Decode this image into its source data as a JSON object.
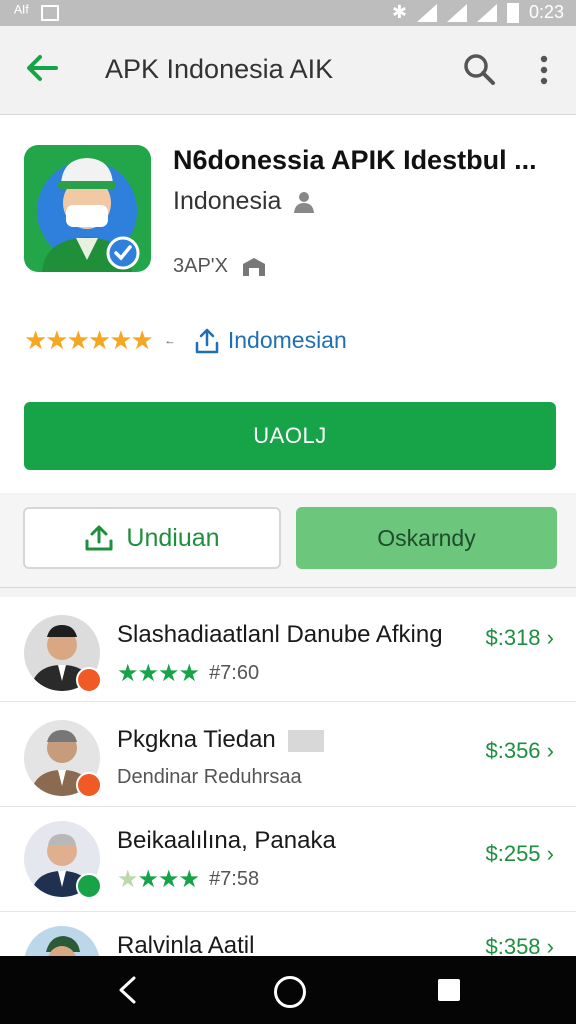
{
  "status_bar": {
    "left_text": "ᴬᴵᶠ",
    "time": "0:23"
  },
  "app_bar": {
    "title": "APK Indonesia AIK",
    "back_icon": "arrow-left-icon",
    "search_icon": "search-icon",
    "more_icon": "more-vert-icon"
  },
  "app": {
    "name": "N6donessia APIK Idestbul",
    "name_suffix": "...",
    "developer": "Indonesia",
    "meta": "3AP'X",
    "rating_mark": "·̶",
    "language": "Indomesian",
    "install_label": "UAOLJ"
  },
  "actions": {
    "outline_label": "Undiuan",
    "filled_label": "Oskarndy"
  },
  "list": [
    {
      "name": "Slashadiaatlanl Danube Afking",
      "stars": "★★★★",
      "meta": "#7:60",
      "price": "$:318",
      "badge_color": "#f05a24"
    },
    {
      "name": "Pkgkna Tiedan",
      "subtitle": "Dendinar Reduhrsaa",
      "price": "$:356",
      "badge_color": "#f05a24"
    },
    {
      "name": "Beikaalılına, Panaka",
      "stars": "★★★",
      "stars_faded": "★",
      "meta": "#7:58",
      "price": "$:255",
      "badge_color": "#17a448"
    },
    {
      "name": "Ralvinla Aatil",
      "price": "$:358"
    }
  ],
  "colors": {
    "accent": "#17a448",
    "star": "#f5a623",
    "link": "#1e6fb5"
  }
}
